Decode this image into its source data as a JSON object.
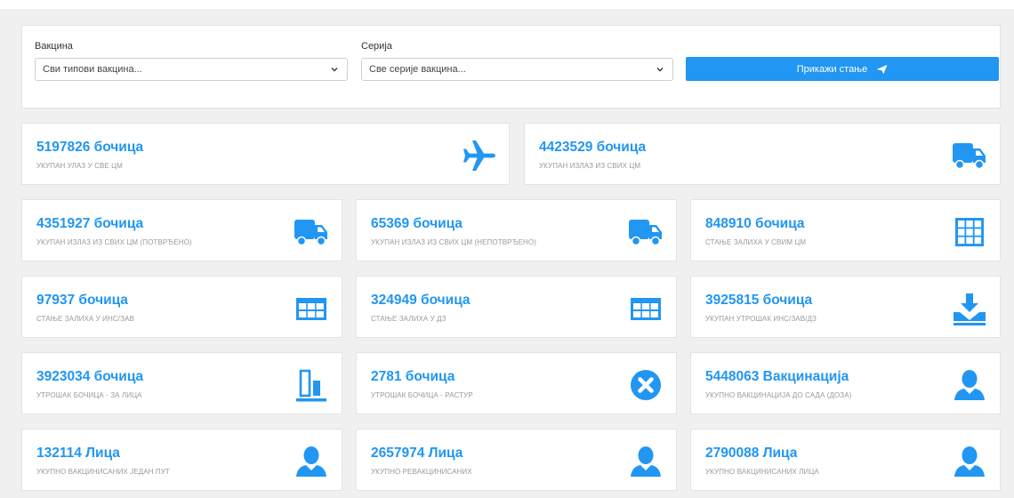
{
  "filters": {
    "vaccine_label": "Вакцина",
    "vaccine_value": "Сви типови вакцина...",
    "series_label": "Серија",
    "series_value": "Све серије вакцина...",
    "show_button": "Прикажи стање"
  },
  "colors": {
    "accent": "#2196f3",
    "label": "#9a9a9a"
  },
  "cards": [
    {
      "value": "5197826 бочица",
      "label": "УКУПАН УЛАЗ У СВЕ ЦМ",
      "icon": "airplane-icon"
    },
    {
      "value": "4423529 бочица",
      "label": "УКУПАН ИЗЛАЗ ИЗ СВИХ ЦМ",
      "icon": "truck-icon"
    },
    {
      "value": "4351927 бочица",
      "label": "УКУПАН ИЗЛАЗ ИЗ СВИХ ЦМ (ПОТВРЂЕНО)",
      "icon": "truck-icon"
    },
    {
      "value": "65369 бочица",
      "label": "УКУПАН ИЗЛАЗ ИЗ СВИХ ЦМ (НЕПОТВРЂЕНО)",
      "icon": "truck-icon"
    },
    {
      "value": "848910 бочица",
      "label": "СТАЊЕ ЗАЛИХА У СВИМ ЦМ",
      "icon": "grid-icon"
    },
    {
      "value": "97937 бочица",
      "label": "СТАЊЕ ЗАЛИХА У ИНС/ЗАВ",
      "icon": "table-icon"
    },
    {
      "value": "324949 бочица",
      "label": "СТАЊЕ ЗАЛИХА У ДЗ",
      "icon": "table-icon"
    },
    {
      "value": "3925815 бочица",
      "label": "УКУПАН УТРОШАК ИНС/ЗАВ/ДЗ",
      "icon": "download-tray-icon"
    },
    {
      "value": "3923034 бочица",
      "label": "УТРОШАК БОЧИЦА - ЗА ЛИЦА",
      "icon": "bar-chart-icon"
    },
    {
      "value": "2781 бочица",
      "label": "УТРОШАК БОЧИЦА - РАСТУР",
      "icon": "x-circle-icon"
    },
    {
      "value": "5448063 Вакцинација",
      "label": "УКУПНО ВАКЦИНАЦИЈА ДО САДА (ДОЗА)",
      "icon": "user-icon"
    },
    {
      "value": "132114 Лица",
      "label": "УКУПНО ВАКЦИНИСАНИХ ЈЕДАН ПУТ",
      "icon": "user-icon"
    },
    {
      "value": "2657974 Лица",
      "label": "УКУПНО РЕВАКЦИНИСАНИХ",
      "icon": "user-icon"
    },
    {
      "value": "2790088 Лица",
      "label": "УКУПНО ВАКЦИНИСАНИХ ЛИЦА",
      "icon": "user-icon"
    }
  ]
}
